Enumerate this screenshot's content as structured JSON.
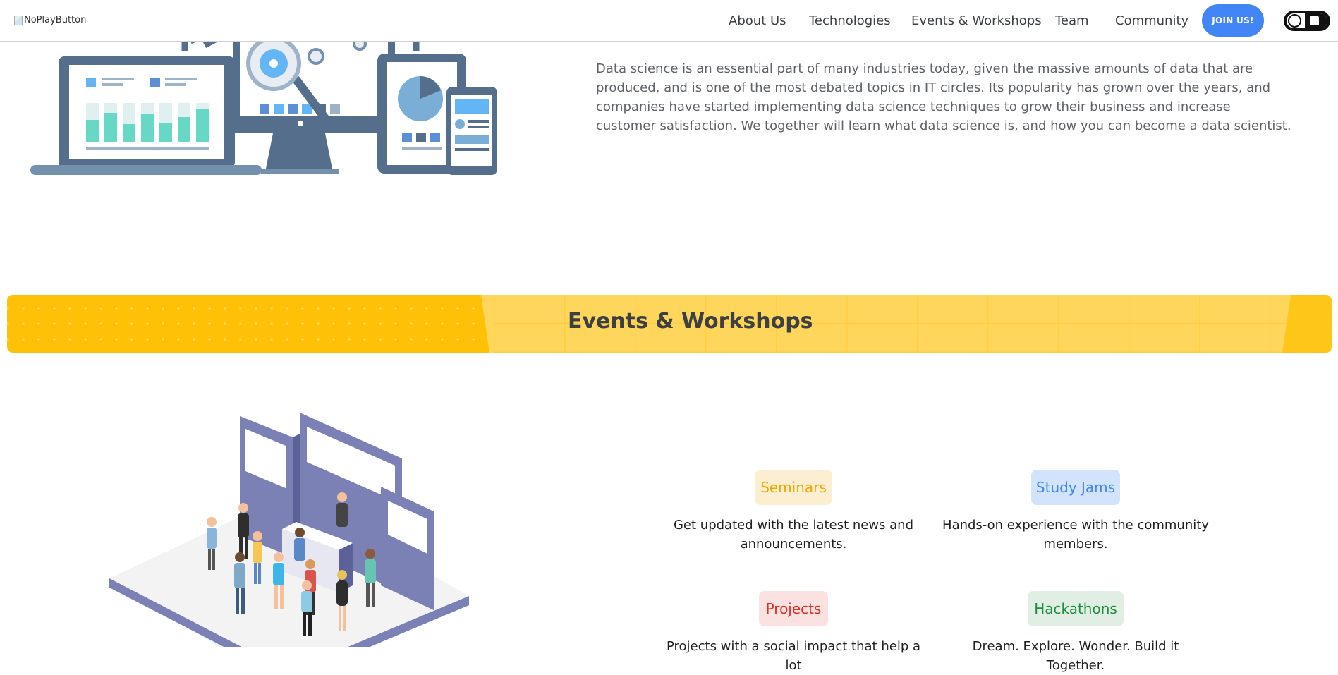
{
  "navbar": {
    "logo_alt": "NoPlayButton",
    "links": [
      "About Us",
      "Technologies",
      "Events & Workshops",
      "Team",
      "Community"
    ],
    "join_label": "JOIN US!"
  },
  "about": {
    "text": "Data science is an essential part of many industries today, given the massive amounts of data that are produced, and is one of the most debated topics in IT circles. Its popularity has grown over the years, and companies have started implementing data science techniques to grow their business and increase customer satisfaction. We together will learn what data science is, and how you can become a data scientist."
  },
  "events": {
    "banner_title": "Events & Workshops",
    "items": [
      {
        "label": "Seminars",
        "desc": "Get updated with the latest news and announcements.",
        "color": "#f2a600"
      },
      {
        "label": "Study Jams",
        "desc": "Hands-on experience with the community members.",
        "color": "#4285f4"
      },
      {
        "label": "Projects",
        "desc": "Projects with a social impact that help a lot",
        "color": "#d93025"
      },
      {
        "label": "Hackathons",
        "desc": "Dream. Explore. Wonder. Build it Together.",
        "color": "#1e8e3e"
      }
    ]
  },
  "colors": {
    "accent_blue": "#4285f4",
    "banner_yellow": "#ffc107",
    "text_dark": "#3c4043"
  },
  "icons": [
    "broken-image-icon",
    "theme-toggle-icon"
  ]
}
